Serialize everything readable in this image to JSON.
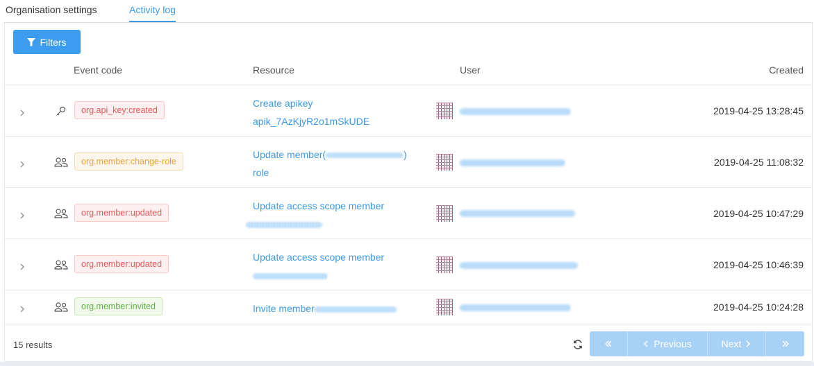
{
  "tabs": [
    {
      "label": "Organisation settings",
      "active": false
    },
    {
      "label": "Activity log",
      "active": true
    }
  ],
  "toolbar": {
    "filters_label": "Filters",
    "filters_icon": "filter-icon"
  },
  "table": {
    "headers": {
      "event_code": "Event code",
      "resource": "Resource",
      "user": "User",
      "created": "Created"
    },
    "rows": [
      {
        "icon": "key-icon",
        "event_code": "org.api_key:created",
        "badge_color": "red",
        "resource_line1": "Create apikey",
        "resource_line2": "apik_7AzKjyR2o1mSkUDE",
        "created": "2019-04-25 13:28:45"
      },
      {
        "icon": "users-icon",
        "event_code": "org.member:change-role",
        "badge_color": "orange",
        "resource_line1": "Update member(",
        "resource_line1_suffix": ")",
        "resource_line2": "role",
        "created": "2019-04-25 11:08:32"
      },
      {
        "icon": "users-icon",
        "event_code": "org.member:updated",
        "badge_color": "red",
        "resource_line1": "Update access scope member",
        "resource_line2": "",
        "created": "2019-04-25 10:47:29"
      },
      {
        "icon": "users-icon",
        "event_code": "org.member:updated",
        "badge_color": "red",
        "resource_line1": "Update access scope member",
        "resource_line2": "",
        "created": "2019-04-25 10:46:39"
      },
      {
        "icon": "users-icon",
        "event_code": "org.member:invited",
        "badge_color": "green",
        "resource_line1": "Invite member",
        "resource_line2": "",
        "created": "2019-04-25 10:24:28"
      }
    ]
  },
  "footer": {
    "results": "15 results",
    "pager": {
      "previous": "Previous",
      "next": "Next"
    }
  },
  "colors": {
    "accent": "#3b9cf0",
    "badge_red": "#e8595b",
    "badge_orange": "#e8a238",
    "badge_green": "#5fb246"
  }
}
